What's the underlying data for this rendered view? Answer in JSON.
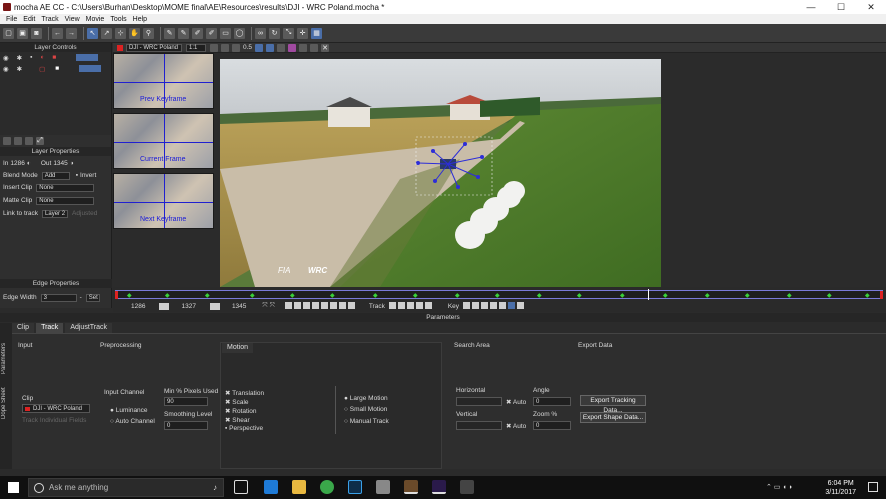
{
  "window": {
    "title": "mocha AE CC - C:\\Users\\Burhan\\Desktop\\MOME final\\AE\\Resources\\results\\DJI - WRC Poland.mocha *"
  },
  "menu": [
    "File",
    "Edit",
    "Track",
    "View",
    "Movie",
    "Tools",
    "Help"
  ],
  "viewer_bar": {
    "clip": "DJI - WRC Poland",
    "zoom": "1:1",
    "value": "0.5"
  },
  "layer_controls": {
    "title": "Layer Controls"
  },
  "layer_properties": {
    "title": "Layer Properties",
    "in_label": "In",
    "in_value": "1286",
    "out_label": "Out",
    "out_value": "1345",
    "blend_label": "Blend Mode",
    "blend_value": "Add",
    "invert_label": "Invert",
    "insert_label": "Insert Clip",
    "insert_value": "None",
    "matte_label": "Matte Clip",
    "matte_value": "None",
    "link_label": "Link to track",
    "link_value": "Layer 2",
    "adjusted_label": "Adjusted"
  },
  "edge_properties": {
    "title": "Edge Properties",
    "width_label": "Edge Width",
    "width_value": "3",
    "set_label": "Set"
  },
  "thumbs": [
    "Prev Keyframe",
    "Current Frame",
    "Next Keyframe"
  ],
  "viewer": {
    "logo_fia": "FIA",
    "logo_wrc": "WRC"
  },
  "timeline": {
    "start": "1286",
    "current": "1327",
    "end": "1345",
    "track_label": "Track",
    "key_label": "Key"
  },
  "params": {
    "header": "Parameters",
    "tabs": [
      "Clip",
      "Track",
      "AdjustTrack"
    ],
    "side_tabs": [
      "Parameters",
      "Dope Sheet"
    ],
    "input": {
      "title": "Input",
      "clip_label": "Clip",
      "clip_value": "DJI - WRC Poland",
      "track_individual": "Track Individual Fields"
    },
    "preprocessing": {
      "title": "Preprocessing",
      "input_channel": "Input Channel",
      "luminance": "Luminance",
      "auto_channel": "Auto Channel",
      "min_pixels_label": "Min % Pixels Used",
      "min_pixels_value": "90",
      "smoothing_label": "Smoothing Level",
      "smoothing_value": "0"
    },
    "motion": {
      "title": "Motion",
      "translation": "Translation",
      "scale": "Scale",
      "rotation": "Rotation",
      "shear": "Shear",
      "perspective": "Perspective",
      "large": "Large Motion",
      "small": "Small Motion",
      "manual": "Manual Track"
    },
    "search_area": {
      "title": "Search Area",
      "horizontal": "Horizontal",
      "vertical": "Vertical",
      "auto": "Auto",
      "angle_label": "Angle",
      "angle_value": "0",
      "zoom_label": "Zoom %",
      "zoom_value": "0"
    },
    "export": {
      "title": "Export Data",
      "tracking_btn": "Export Tracking Data...",
      "shape_btn": "Export Shape Data..."
    }
  },
  "taskbar": {
    "search_placeholder": "Ask me anything",
    "time": "6:04 PM",
    "date": "3/11/2017"
  }
}
